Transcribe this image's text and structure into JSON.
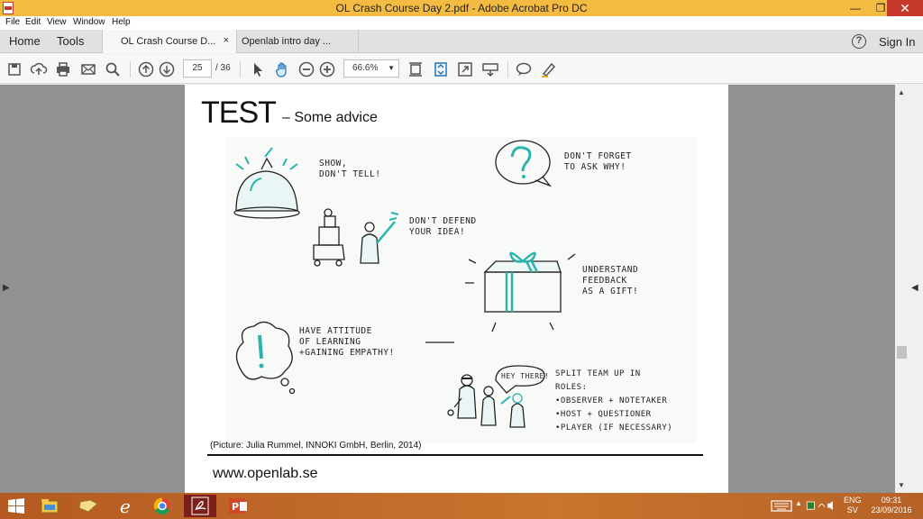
{
  "window": {
    "title": "OL Crash Course Day 2.pdf - Adobe Acrobat Pro DC",
    "min_glyph": "—",
    "max_glyph": "❐",
    "close_glyph": "✕"
  },
  "menu": {
    "items": [
      "File",
      "Edit",
      "View",
      "Window",
      "Help"
    ]
  },
  "tabs": {
    "home": "Home",
    "tools": "Tools",
    "documents": [
      {
        "label": "OL Crash Course D...",
        "close": "×",
        "active": true
      },
      {
        "label": "Openlab intro day ...",
        "active": false
      }
    ],
    "help": "?",
    "sign_in": "Sign In"
  },
  "toolbar": {
    "current_page": "25",
    "total_pages": "/ 36",
    "zoom": "66.6%",
    "caret": "▼",
    "icons": [
      "save-icon",
      "upload-icon",
      "print-icon",
      "email-icon",
      "search-icon",
      "page-up-icon",
      "page-down-icon",
      "select-cursor-icon",
      "hand-icon",
      "zoom-out-icon",
      "zoom-in-icon",
      "fit-page-icon",
      "scroll-mode-icon",
      "fullscreen-icon",
      "keyboard-icon",
      "comment-icon",
      "highlight-pen-icon"
    ]
  },
  "slide": {
    "title": "TEST",
    "subtitle": "– Some advice",
    "notes": {
      "show": "SHOW,\nDON'T TELL!",
      "forget": "DON'T FORGET\nTO ASK WHY!",
      "defend": "DON'T DEFEND\nYOUR IDEA!",
      "feedback": "UNDERSTAND\nFEEDBACK\nAS A GIFT!",
      "attitude": "HAVE ATTITUDE\nOF LEARNING\n+GAINING EMPATHY!",
      "hey": "HEY THERE!",
      "split": "SPLIT TEAM UP IN\nROLES:\n•OBSERVER + NOTETAKER\n•HOST + QUESTIONER\n•PLAYER (IF NECESSARY)"
    },
    "credit": "(Picture: Julia Rummel, INNOKI GmbH, Berlin, 2014)",
    "footer_url": "www.openlab.se"
  },
  "nav": {
    "left": "▶",
    "right": "◀",
    "up": "▲",
    "down": "▼"
  },
  "taskbar": {
    "apps": [
      "windows-start-icon",
      "file-explorer-icon",
      "folder-icon",
      "internet-explorer-icon",
      "chrome-icon",
      "acrobat-icon",
      "powerpoint-icon"
    ],
    "tray_up": "▲",
    "language": "ENG",
    "locale": "SV",
    "time": "09:31",
    "date": "23/09/2016"
  },
  "colors": {
    "titlebar": "#f4bb43",
    "close": "#c7382c",
    "teal": "#2bb3ad",
    "taskbar": "#c06a28"
  }
}
